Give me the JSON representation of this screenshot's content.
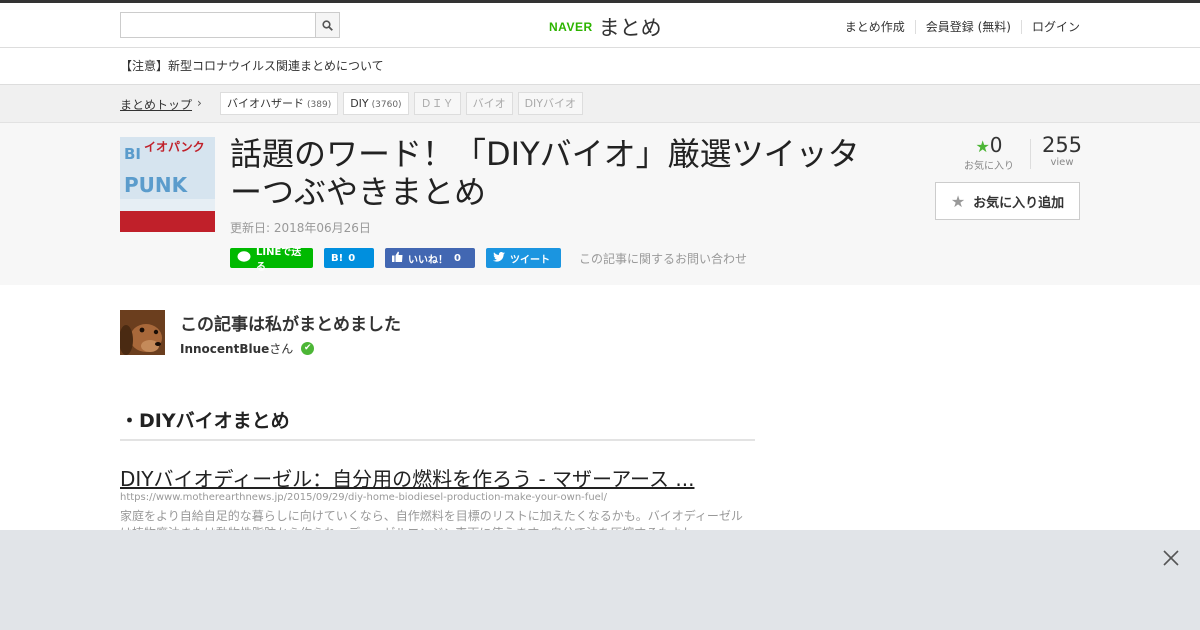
{
  "header": {
    "search_placeholder": "",
    "search_icon": "search-icon",
    "logo_brand": "NAVER",
    "logo_text": "まとめ",
    "nav": [
      "まとめ作成",
      "会員登録 (無料)",
      "ログイン"
    ]
  },
  "notice": "【注意】新型コロナウイルス関連まとめについて",
  "breadcrumb": {
    "home": "まとめトップ",
    "chevron": "›",
    "tags": [
      {
        "label": "バイオハザード",
        "count": "(389)"
      },
      {
        "label": "DIY",
        "count": "(3760)"
      },
      {
        "label": "ＤＩＹ",
        "count": ""
      },
      {
        "label": "バイオ",
        "count": ""
      },
      {
        "label": "DIYバイオ",
        "count": ""
      }
    ]
  },
  "article": {
    "title": "話題のワード！「DIYバイオ」厳選ツイッターつぶやきまとめ",
    "updated": "更新日: 2018年06月26日",
    "thumb_text_1": "イオパンク",
    "thumb_text_2": "BIO PUNK",
    "inquiry": "この記事に関するお問い合わせ"
  },
  "share": {
    "line": "LINEで送る",
    "hatena_icon": "B!",
    "hatena_count": "0",
    "fb_label": "いいね！",
    "fb_count": "0",
    "tweet": "ツイート"
  },
  "stats": {
    "fav_count": "0",
    "fav_label": "お気に入り",
    "views": "255",
    "views_label": "view",
    "fav_button": "お気に入り追加"
  },
  "author": {
    "heading": "この記事は私がまとめました",
    "name": "InnocentBlue",
    "suffix": "さん"
  },
  "content": {
    "section_title": "・DIYバイオまとめ",
    "link_title": "DIYバイオディーゼル：自分用の燃料を作ろう - マザーアース ...",
    "link_url": "https://www.motherearthnews.jp/2015/09/29/diy-home-biodiesel-production-make-your-own-fuel/",
    "link_desc": "家庭をより自給自足的な暮らしに向けていくなら、自作燃料を目標のリストに加えたくなるかも。バイオディーゼルは植物廃油または動物性脂肪から作られ、ディーゼルエンジン車両に使えます。自分で油を圧搾するもよし、"
  },
  "ad": {
    "close_icon": "close-icon"
  },
  "colors": {
    "naver_green": "#2db400",
    "line_green": "#00b900",
    "hatena_blue": "#008fde",
    "facebook_blue": "#4267b2",
    "twitter_blue": "#1b95e0"
  }
}
